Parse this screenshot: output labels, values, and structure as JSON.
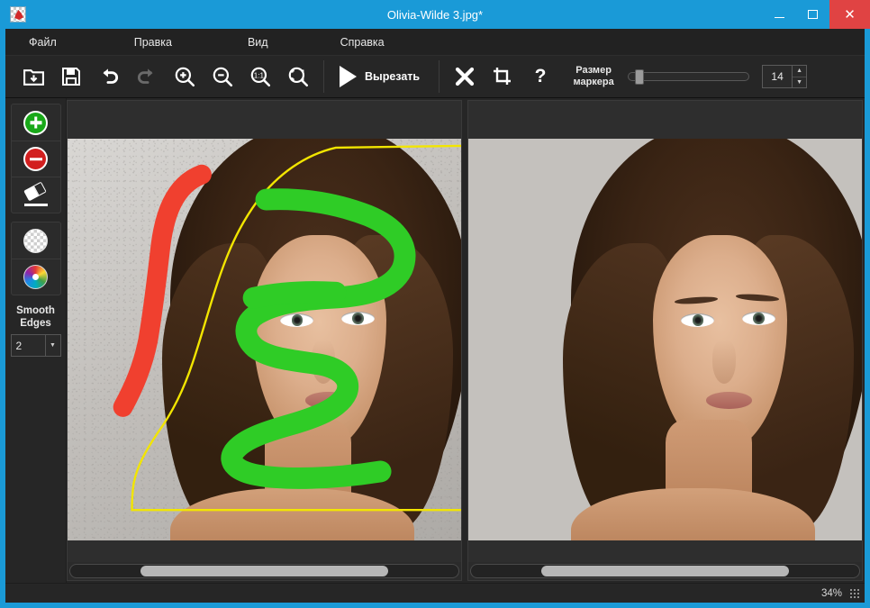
{
  "window": {
    "title": "Olivia-Wilde 3.jpg*",
    "app_icon": "app-logo-icon",
    "accent_color": "#1a9ad7",
    "minimize_label": "",
    "maximize_label": "",
    "close_label": "✕"
  },
  "menu": {
    "items": [
      {
        "label": "Файл"
      },
      {
        "label": "Правка"
      },
      {
        "label": "Вид"
      },
      {
        "label": "Справка"
      }
    ]
  },
  "toolbar": {
    "buttons": [
      {
        "name": "open-file",
        "icon": "folder-open-icon"
      },
      {
        "name": "save-file",
        "icon": "save-disk-icon"
      },
      {
        "name": "undo",
        "icon": "undo-arrow-icon"
      },
      {
        "name": "redo",
        "icon": "redo-arrow-icon",
        "disabled": true
      },
      {
        "name": "zoom-in",
        "icon": "zoom-in-icon"
      },
      {
        "name": "zoom-out",
        "icon": "zoom-out-icon"
      },
      {
        "name": "zoom-actual",
        "icon": "zoom-1-1-icon"
      },
      {
        "name": "zoom-fit",
        "icon": "zoom-fit-icon"
      }
    ],
    "cut_label": "Вырезать",
    "clear_icon": "x-cross-icon",
    "crop_icon": "crop-icon",
    "help_icon": "question-mark-icon",
    "marker_size_label_line1": "Размер",
    "marker_size_label_line2": "маркера",
    "marker_size_value": "14",
    "marker_slider_percent": 4
  },
  "sidebar": {
    "tools": [
      {
        "name": "keep-marker",
        "icon": "green-plus-icon",
        "color": "#19a819"
      },
      {
        "name": "remove-marker",
        "icon": "red-minus-icon",
        "color": "#d21f1f"
      },
      {
        "name": "eraser",
        "icon": "eraser-icon"
      }
    ],
    "backgrounds": [
      {
        "name": "transparent-background",
        "icon": "checkerboard-circle-icon"
      },
      {
        "name": "color-background",
        "icon": "color-wheel-icon"
      }
    ],
    "smooth_edges_line1": "Smooth",
    "smooth_edges_line2": "Edges",
    "smooth_edges_value": "2"
  },
  "panes": {
    "source": {
      "name": "source-image",
      "scroll_thumb_left_percent": 18,
      "scroll_thumb_width_percent": 64
    },
    "result": {
      "name": "result-image",
      "scroll_thumb_left_percent": 18,
      "scroll_thumb_width_percent": 64
    }
  },
  "statusbar": {
    "zoom_level": "34%",
    "grip_icon": "resize-grip-icon"
  }
}
